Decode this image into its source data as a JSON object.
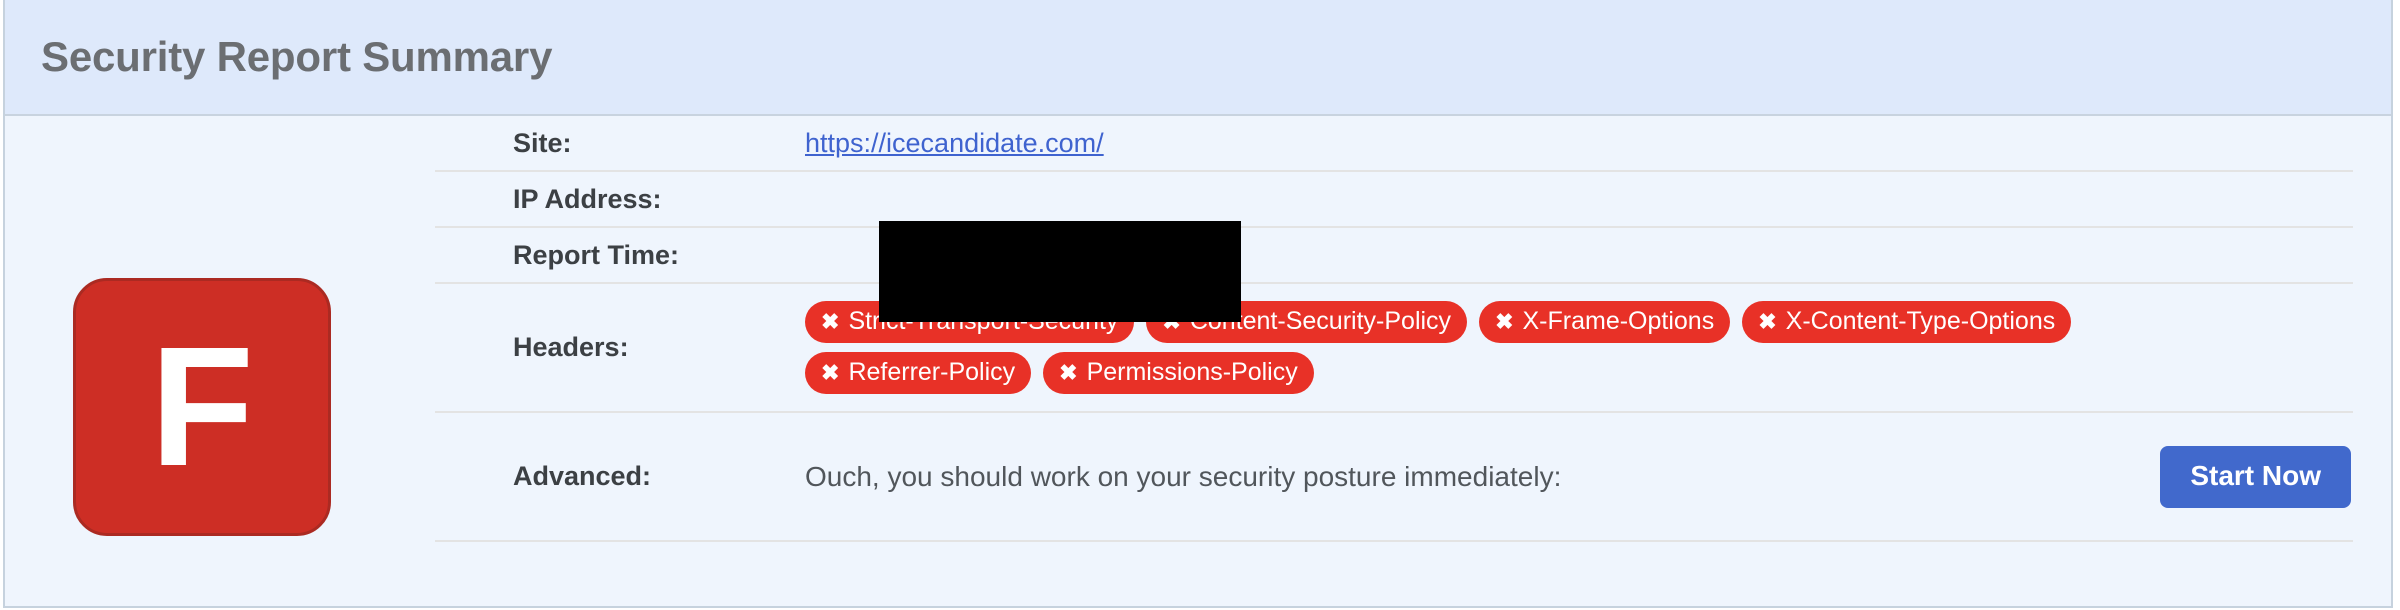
{
  "header": {
    "title": "Security Report Summary"
  },
  "grade": {
    "letter": "F",
    "color": "#cd2e25",
    "border_color": "#ab2a22"
  },
  "rows": {
    "site": {
      "label": "Site:",
      "url_text": "https://icecandidate.com/"
    },
    "ip": {
      "label": "IP Address:",
      "value": ""
    },
    "report_time": {
      "label": "Report Time:",
      "value": ""
    },
    "headers": {
      "label": "Headers:"
    },
    "advanced": {
      "label": "Advanced:",
      "message": "Ouch, you should work on your security posture immediately:",
      "button_label": "Start Now",
      "button_color": "#4169cc"
    }
  },
  "header_pills": [
    {
      "icon": "cross-icon",
      "mark": "✖",
      "label": "Strict-Transport-Security"
    },
    {
      "icon": "cross-icon",
      "mark": "✖",
      "label": "Content-Security-Policy"
    },
    {
      "icon": "cross-icon",
      "mark": "✖",
      "label": "X-Frame-Options"
    },
    {
      "icon": "cross-icon",
      "mark": "✖",
      "label": "X-Content-Type-Options"
    },
    {
      "icon": "cross-icon",
      "mark": "✖",
      "label": "Referrer-Policy"
    },
    {
      "icon": "cross-icon",
      "mark": "✖",
      "label": "Permissions-Policy"
    }
  ],
  "pill_color": "#e83127"
}
